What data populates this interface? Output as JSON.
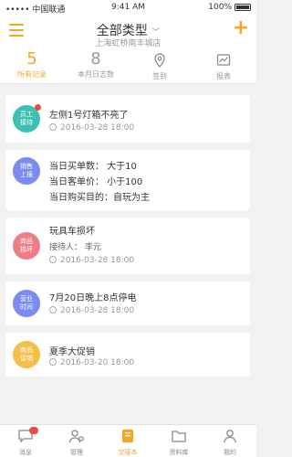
{
  "status_bar": {
    "carrier": "••••• 中国联通 ",
    "time": "9:41 AM",
    "battery": "100%"
  },
  "header": {
    "title": "全部类型",
    "subtitle": "上海虹桥南丰城店"
  },
  "stats": [
    {
      "value": "5",
      "label": "所有记录"
    },
    {
      "value": "8",
      "label": "本月日志数"
    },
    {
      "label": "签到"
    },
    {
      "label": "报表"
    }
  ],
  "cards": [
    {
      "tag": [
        "员工",
        "接待"
      ],
      "color": "#3ec1b4",
      "title": "左侧1号灯箱不亮了",
      "date": "2016-03-28  18:00"
    },
    {
      "tag": [
        "销售",
        "上报"
      ],
      "color": "#7b8cf0",
      "lines": [
        "当日买单数： 大于10",
        "当日客单价： 小于100",
        "当日购买目的：自玩为主"
      ]
    },
    {
      "tag": [
        "商品",
        "损坏"
      ],
      "color": "#ee7e86",
      "title": "玩具车损坏",
      "person": "接待人： 李元",
      "date": "2016-03-28  18:00"
    },
    {
      "tag": [
        "营业",
        "时间"
      ],
      "color": "#7b8cf0",
      "title": "7月20日晚上8点停电",
      "date": "2016-03-28  18:00"
    },
    {
      "tag": [
        "商品",
        "促销"
      ],
      "color": "#f6bf4a",
      "title": "夏季大促销",
      "date": "2016-03-20  18:00"
    }
  ],
  "tabbar": [
    {
      "label": "消息"
    },
    {
      "label": "管理"
    },
    {
      "label": "交接本"
    },
    {
      "label": "资料库"
    },
    {
      "label": "我的"
    }
  ],
  "colors": {
    "accent": "#f5a623",
    "alert": "#e84c3d"
  }
}
